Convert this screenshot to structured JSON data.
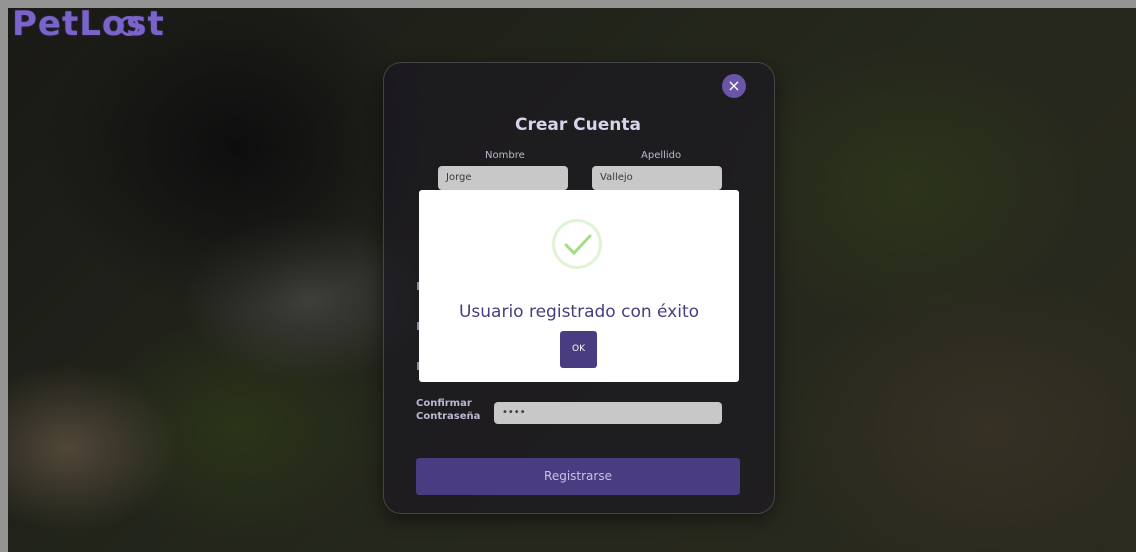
{
  "brand": {
    "name": "PetLost",
    "tagline": ""
  },
  "form": {
    "title": "Crear Cuenta",
    "labels": {
      "nombre": "Nombre",
      "apellido": "Apellido",
      "confirmar": "Confirmar Contraseña"
    },
    "values": {
      "nombre": "Jorge",
      "apellido": "Vallejo",
      "confirmar": "••••"
    },
    "register_label": "Registrarse",
    "close_symbol": "×"
  },
  "alert": {
    "message": "Usuario registrado con éxito",
    "ok_label": "OK",
    "icon": "check-icon"
  },
  "colors": {
    "accent": "#4a3c80",
    "success": "#a5dc86"
  }
}
